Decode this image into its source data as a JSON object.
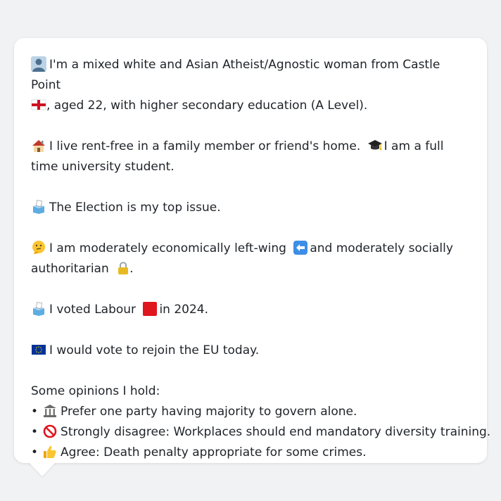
{
  "profile": {
    "identity_text": "I'm a mixed white and Asian Atheist/Agnostic woman from Castle Point",
    "identity_suffix": ", aged 22, with higher secondary education (A Level).",
    "housing_text": "I live rent-free in a family member or friend's home.",
    "student_text": "I am a full time university student.",
    "top_issue_text": "The Election is my top issue.",
    "ideology_left_text": "I am moderately economically left-wing",
    "ideology_right_text": "and moderately socially authoritarian",
    "ideology_end": ".",
    "voted_prefix": "I voted Labour",
    "voted_suffix": "in 2024.",
    "eu_text": "I would vote to rejoin the EU today."
  },
  "opinions": {
    "title": "Some opinions I hold:",
    "bullet": "•",
    "items": [
      {
        "text": "Prefer one party having majority to govern alone.",
        "icon": "classical-building-icon"
      },
      {
        "text": "Strongly disagree: Workplaces should end mandatory diversity training.",
        "icon": "prohibited-icon"
      },
      {
        "text": "Agree: Death penalty appropriate for some crimes.",
        "icon": "thumbs-up-icon"
      }
    ]
  },
  "icons": [
    "person-silhouette-icon",
    "england-flag-icon",
    "house-icon",
    "graduation-cap-icon",
    "ballot-box-icon",
    "thinking-face-icon",
    "left-arrow-icon",
    "lock-icon",
    "red-square-icon",
    "eu-flag-icon"
  ],
  "colors": {
    "page_background": "#f1f2f4",
    "card_background": "#ffffff",
    "text": "#1f2328",
    "labour_red": "#e0161f",
    "eu_blue": "#003399"
  }
}
